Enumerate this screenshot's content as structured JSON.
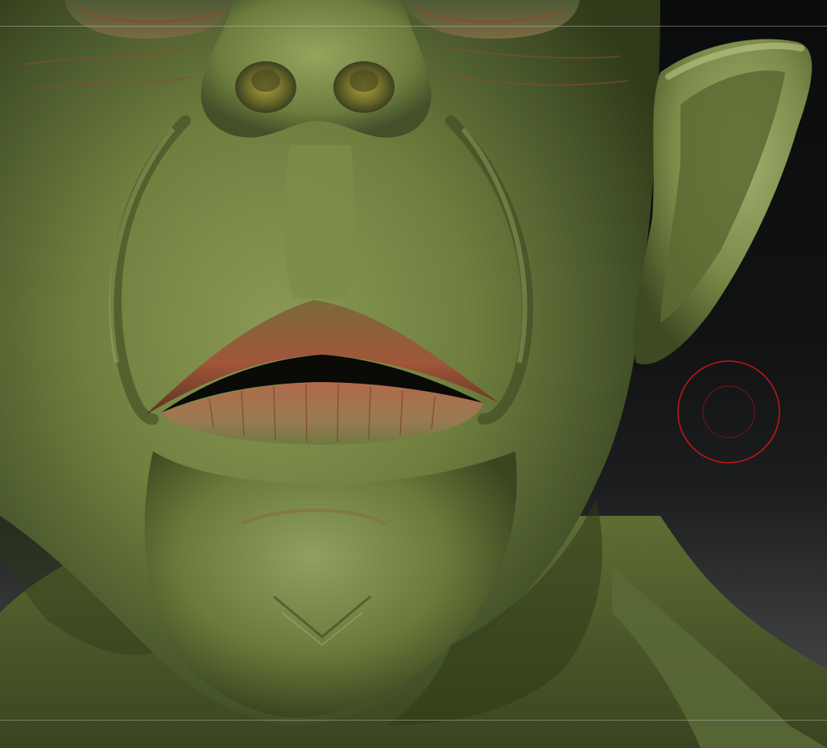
{
  "app": {
    "name": "",
    "view": "3d-sculpt-viewport"
  },
  "viewport": {
    "subject": "sculpted-creature-head",
    "background_top": "#0b0c0d",
    "background_bottom": "#4a4b4c",
    "skin_color": "#6f7f3e",
    "skin_shadow": "#2f3a18",
    "lip_color": "#9a5a3a"
  },
  "brush_cursor": {
    "outer_ring_color": "#c8141c",
    "inner_ring_color": "#6a1418"
  },
  "guides": {
    "color": "#c8c8c8"
  }
}
